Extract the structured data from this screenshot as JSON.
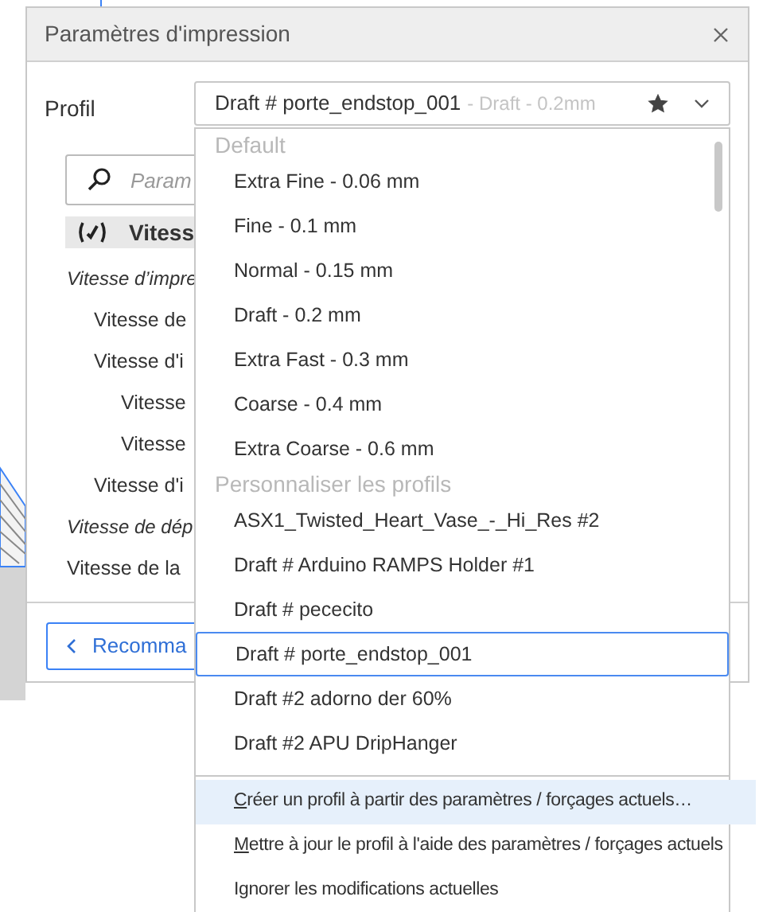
{
  "dialog": {
    "title": "Paramètres d'impression"
  },
  "profile": {
    "label": "Profil",
    "value": "Draft # porte_endstop_001",
    "detail": "- Draft - 0.2mm",
    "favorite": true
  },
  "search": {
    "placeholder": "Param"
  },
  "settings_tree": [
    {
      "kind": "header",
      "label": "Vitess",
      "checked": true,
      "children": [
        {
          "kind": "group",
          "label": "Vitesse d’impre",
          "children": [
            {
              "kind": "item",
              "label": "Vitesse de"
            },
            {
              "kind": "item",
              "label": "Vitesse d'i",
              "children": [
                {
                  "kind": "item",
                  "label": "Vitesse"
                },
                {
                  "kind": "item",
                  "label": "Vitesse"
                }
              ]
            },
            {
              "kind": "item",
              "label": "Vitesse d'i"
            }
          ]
        },
        {
          "kind": "group",
          "label": "Vitesse de dép"
        },
        {
          "kind": "item",
          "label": "Vitesse de la"
        }
      ]
    }
  ],
  "recommended_button": {
    "label": "Recomma"
  },
  "dropdown": {
    "sections": [
      {
        "title": "Default",
        "items": [
          {
            "label": "Extra Fine - 0.06 mm",
            "selected": false
          },
          {
            "label": "Fine - 0.1 mm",
            "selected": false
          },
          {
            "label": "Normal - 0.15 mm",
            "selected": false
          },
          {
            "label": "Draft - 0.2 mm",
            "selected": false
          },
          {
            "label": "Extra Fast - 0.3 mm",
            "selected": false
          },
          {
            "label": "Coarse - 0.4 mm",
            "selected": false
          },
          {
            "label": "Extra Coarse - 0.6 mm",
            "selected": false
          }
        ]
      },
      {
        "title": "Personnaliser les profils",
        "items": [
          {
            "label": "ASX1_Twisted_Heart_Vase_-_Hi_Res #2",
            "selected": false
          },
          {
            "label": "Draft # Arduino RAMPS Holder #1",
            "selected": false
          },
          {
            "label": "Draft # pececito",
            "selected": false
          },
          {
            "label": "Draft # porte_endstop_001",
            "selected": true
          },
          {
            "label": "Draft #2 adorno der 60%",
            "selected": false
          },
          {
            "label": "Draft #2 APU DripHanger",
            "selected": false
          }
        ]
      }
    ],
    "actions": [
      {
        "label": "Créer un profil à partir des paramètres / forçages actuels…",
        "underline_first": true,
        "hovered": true
      },
      {
        "label": "Mettre à jour le profil à l'aide des paramètres / forçages actuels",
        "underline_first": true,
        "hovered": false
      },
      {
        "label": "Ignorer les modifications actuelles",
        "underline_first": false,
        "hovered": false
      }
    ]
  }
}
